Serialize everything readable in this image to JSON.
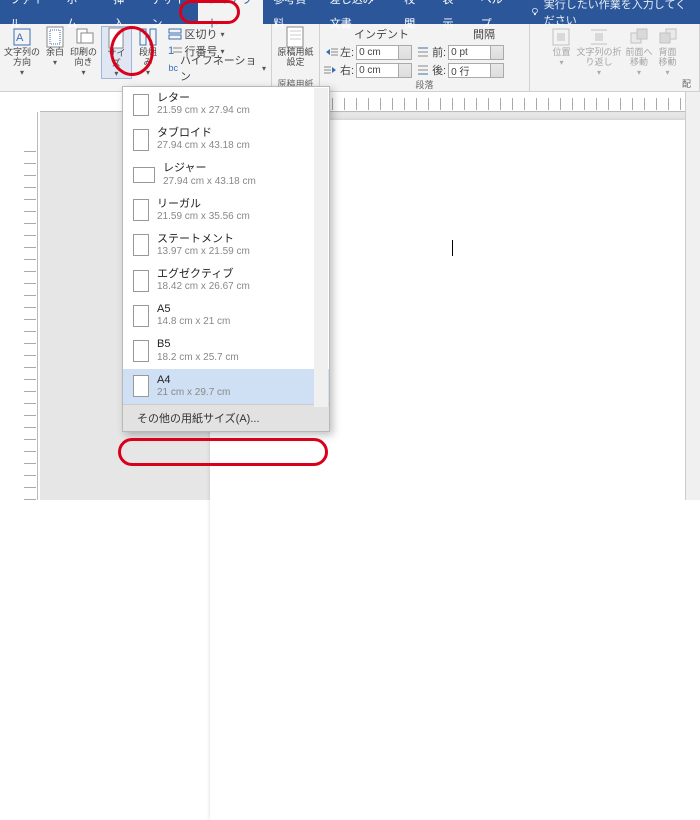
{
  "tabs": [
    "ファイル",
    "ホーム",
    "挿入",
    "デザイン",
    "レイアウト",
    "参考資料",
    "差し込み文書",
    "校閲",
    "表示",
    "ヘルプ"
  ],
  "active_tab_index": 4,
  "tell_me": "実行したい作業を入力してください",
  "ribbon": {
    "page_setup": {
      "text_dir": "文字列の\n方向",
      "margins": "余白",
      "orientation": "印刷の\n向き",
      "size": "サイズ",
      "columns": "段組み",
      "breaks": "区切り",
      "line_no": "行番号",
      "hyphen": "ハイフネーション"
    },
    "manuscript": {
      "btn": "原稿用紙\n設定",
      "label": "原稿用紙"
    },
    "paragraph": {
      "indent": "インデント",
      "spacing": "間隔",
      "left_label": "左:",
      "right_label": "右:",
      "before_label": "前:",
      "after_label": "後:",
      "left": "0 cm",
      "right": "0 cm",
      "before": "0 pt",
      "after": "0 行",
      "label": "段落"
    },
    "arrange": {
      "position": "位置",
      "wrap": "文字列の折\nり返し",
      "front": "前面へ\n移動",
      "back": "背面\n移動",
      "label": "配"
    }
  },
  "size_menu": [
    {
      "name": "レター",
      "dim": "21.59 cm x 27.94 cm"
    },
    {
      "name": "タブロイド",
      "dim": "27.94 cm x 43.18 cm"
    },
    {
      "name": "レジャー",
      "dim": "27.94 cm x 43.18 cm",
      "wide": true
    },
    {
      "name": "リーガル",
      "dim": "21.59 cm x 35.56 cm"
    },
    {
      "name": "ステートメント",
      "dim": "13.97 cm x 21.59 cm"
    },
    {
      "name": "エグゼクティブ",
      "dim": "18.42 cm x 26.67 cm"
    },
    {
      "name": "A5",
      "dim": "14.8 cm x 21 cm"
    },
    {
      "name": "B5",
      "dim": "18.2 cm x 25.7 cm"
    },
    {
      "name": "A4",
      "dim": "21 cm x 29.7 cm",
      "sel": true
    }
  ],
  "size_menu_more": "その他の用紙サイズ(A)..."
}
